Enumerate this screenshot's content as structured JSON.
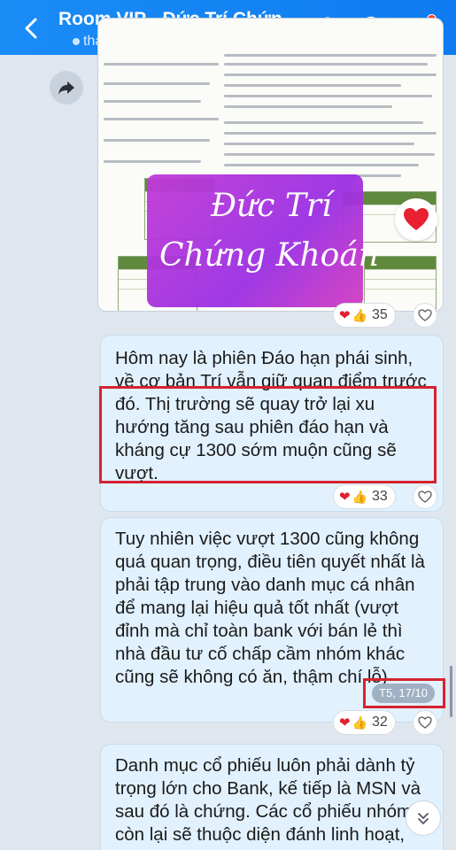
{
  "header": {
    "title": "Room VIP - Đức Trí Chứn...",
    "subtitle": "thành viên",
    "back_icon": "back-arrow-icon",
    "icons": [
      "add-member-icon",
      "search-icon",
      "menu-icon"
    ],
    "colors": {
      "bar": "#1a8cf6",
      "badge": "#ff3b30"
    }
  },
  "messages": [
    {
      "type": "image",
      "watermark": {
        "line1": "Đức Trí",
        "line2": "Chứng Khoán"
      },
      "reaction_count": "35"
    },
    {
      "type": "text",
      "text_intro": "Hôm nay là phiên Đáo hạn phái sinh, về cơ bản Trí vẫn giữ quan điểm trước",
      "text_highlight": "đó. Thị trường sẽ quay trở lại xu hướng tăng sau phiên đáo hạn và kháng cự 1300 sớm muộn cũng sẽ vượt.",
      "reaction_count": "33"
    },
    {
      "type": "text",
      "text": "Tuy nhiên việc vượt 1300 cũng không quá quan trọng, điều tiên quyết nhất là phải tập trung vào danh mục cá nhân để mang lại hiệu quả tốt nhất (vượt đỉnh mà chỉ toàn bank với bán lẻ thì nhà đầu tư cố chấp cầm nhóm khác cũng sẽ không có ăn, thậm chí lỗ)",
      "timestamp": "T5, 17/10",
      "reaction_count": "32"
    },
    {
      "type": "text",
      "text": "Danh mục cổ phiếu luôn phải dành tỷ trọng lớn cho Bank, kế tiếp là MSN và sau đó là chứng. Các cổ phiếu nhóm còn lại sẽ thuộc diện đánh linh hoạt,"
    }
  ]
}
